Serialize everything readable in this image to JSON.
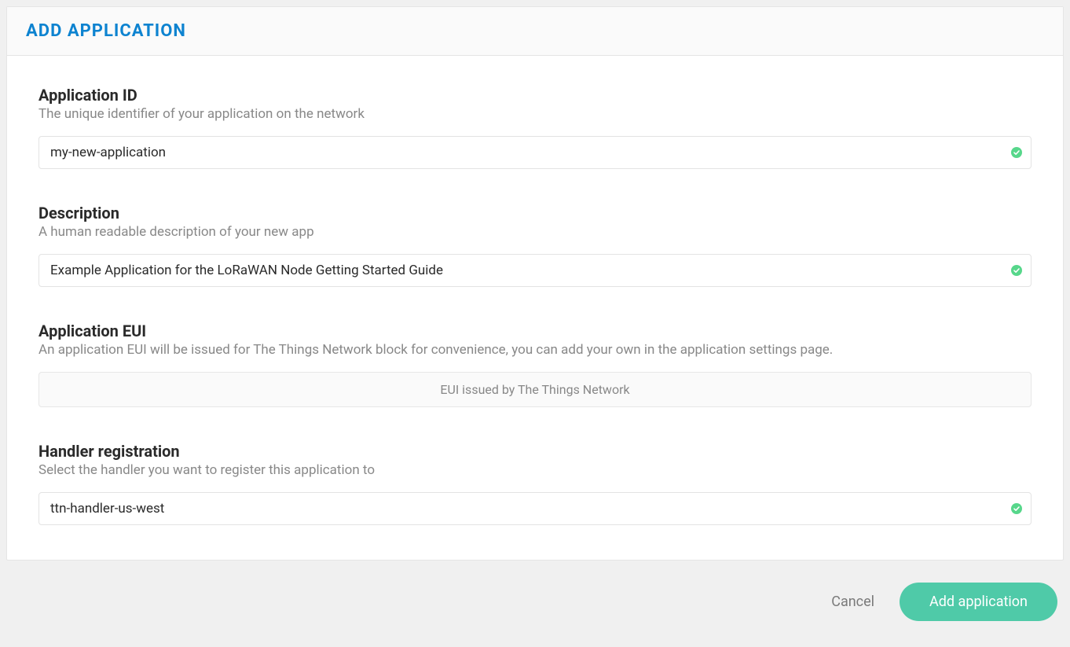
{
  "header": {
    "title": "ADD APPLICATION"
  },
  "fields": {
    "app_id": {
      "label": "Application ID",
      "desc": "The unique identifier of your application on the network",
      "value": "my-new-application"
    },
    "description": {
      "label": "Description",
      "desc": "A human readable description of your new app",
      "value": "Example Application for the LoRaWAN Node Getting Started Guide"
    },
    "app_eui": {
      "label": "Application EUI",
      "desc": "An application EUI will be issued for The Things Network block for convenience, you can add your own in the application settings page.",
      "static_text": "EUI issued by The Things Network"
    },
    "handler": {
      "label": "Handler registration",
      "desc": "Select the handler you want to register this application to",
      "value": "ttn-handler-us-west"
    }
  },
  "footer": {
    "cancel": "Cancel",
    "submit": "Add application"
  },
  "colors": {
    "accent_blue": "#0d83d0",
    "accent_green": "#4fcaa8",
    "valid_green": "#57d78b"
  }
}
